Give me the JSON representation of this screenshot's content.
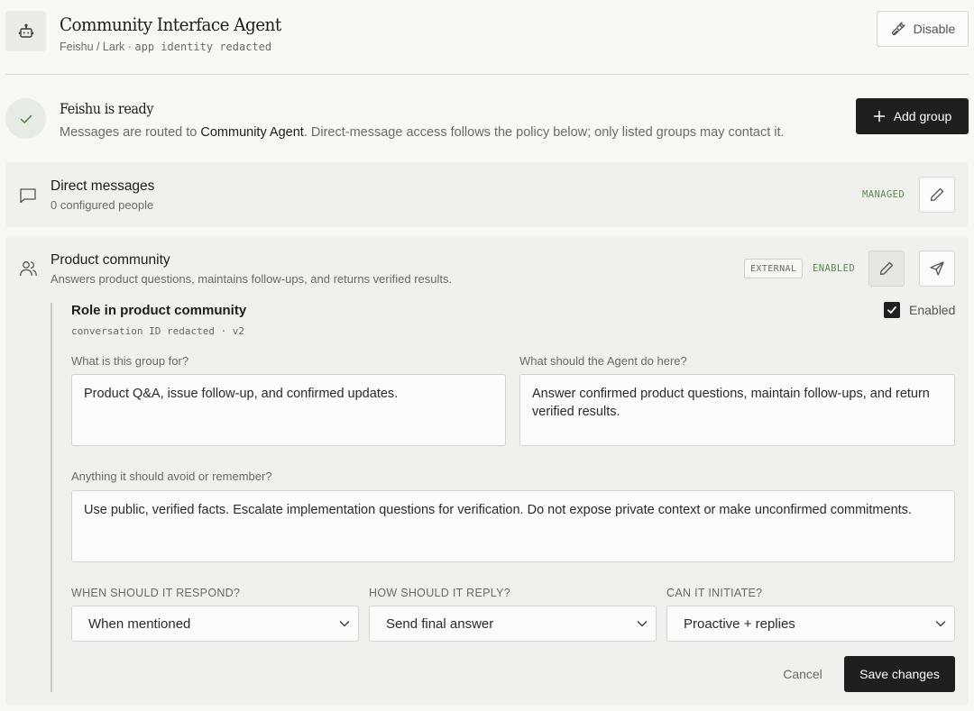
{
  "header": {
    "title": "Community Interface Agent",
    "platform": "Feishu / Lark",
    "separator": "·",
    "identity": "app identity redacted",
    "disable_label": "Disable"
  },
  "status": {
    "title": "Feishu is ready",
    "message_prefix": "Messages are routed to ",
    "agent_name": "Community Agent",
    "message_suffix": ". Direct-message access follows the policy below; only listed groups may contact it.",
    "add_group_label": "Add group"
  },
  "direct_messages": {
    "title": "Direct messages",
    "subtitle": "0 configured people",
    "badge": "MANAGED"
  },
  "group": {
    "title": "Product community",
    "subtitle": "Answers product questions, maintains follow-ups, and returns verified results.",
    "external_badge": "EXTERNAL",
    "enabled_badge": "ENABLED",
    "role": {
      "title": "Role in product community",
      "meta": "conversation ID redacted · v2",
      "enabled_label": "Enabled",
      "enabled": true
    },
    "fields": {
      "purpose_label": "What is this group for?",
      "purpose_value": "Product Q&A, issue follow-up, and confirmed updates.",
      "task_label": "What should the Agent do here?",
      "task_value": "Answer confirmed product questions, maintain follow-ups, and return verified results.",
      "avoid_label": "Anything it should avoid or remember?",
      "avoid_value": "Use public, verified facts. Escalate implementation questions for verification. Do not expose private context or make unconfirmed commitments."
    },
    "selects": {
      "respond_label": "WHEN SHOULD IT RESPOND?",
      "respond_value": "When mentioned",
      "reply_label": "HOW SHOULD IT REPLY?",
      "reply_value": "Send final answer",
      "initiate_label": "CAN IT INITIATE?",
      "initiate_value": "Proactive + replies"
    },
    "cancel_label": "Cancel",
    "save_label": "Save changes"
  },
  "icons": {
    "header": "robot-icon",
    "disable": "plug-disconnect-icon",
    "ready": "check-icon",
    "add": "plus-icon",
    "direct_messages": "chat-bubble-icon",
    "group": "users-icon",
    "edit": "pencil-icon",
    "send": "send-icon",
    "dropdown": "chevron-down-icon"
  },
  "colors": {
    "accent_dark": "#1f1f1d",
    "status_green": "#5b8a55",
    "background": "#f8f8f5",
    "card": "#f0f0ec"
  }
}
